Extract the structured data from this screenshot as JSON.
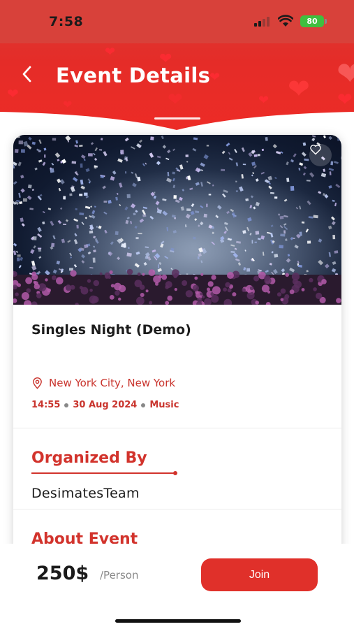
{
  "status_bar": {
    "time": "7:58",
    "battery": "80"
  },
  "header": {
    "title": "Event Details",
    "back_icon": "chevron-left-icon"
  },
  "event": {
    "name": "Singles Night (Demo)",
    "location": "New York City, New York",
    "time": "14:55",
    "date": "30 Aug 2024",
    "category": "Music",
    "image_desc_icon": "event-photo",
    "favorite_icon": "heart-outline-icon"
  },
  "organized": {
    "title": "Organized By",
    "name": "DesimatesTeam"
  },
  "about": {
    "title": "About Event"
  },
  "footer": {
    "price": "250$",
    "unit": "/Person",
    "join_label": "Join"
  },
  "colors": {
    "accent": "#e0302a",
    "header": "#e52c28",
    "text": "#1c1c1c"
  }
}
